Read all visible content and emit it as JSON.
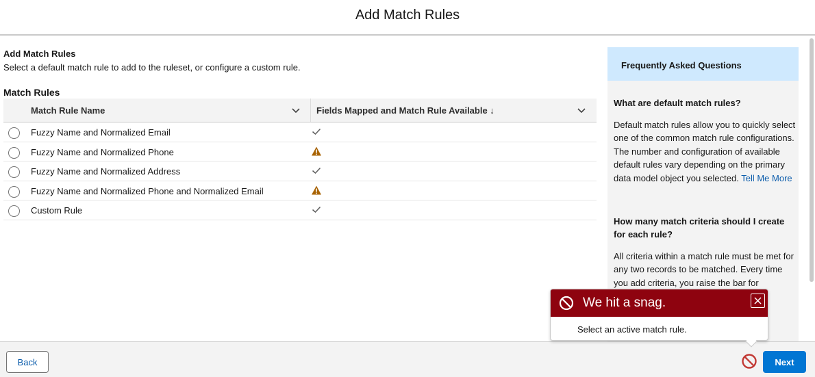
{
  "header": {
    "title": "Add Match Rules"
  },
  "section": {
    "title": "Add Match Rules",
    "description": "Select a default match rule to add to the ruleset, or configure a custom rule."
  },
  "match_rules": {
    "title": "Match Rules",
    "columns": {
      "name": "Match Rule Name",
      "status": "Fields Mapped and Match Rule Available ↓"
    },
    "rows": [
      {
        "name": "Fuzzy Name and Normalized Email",
        "status_icon": "check-icon"
      },
      {
        "name": "Fuzzy Name and Normalized Phone",
        "status_icon": "warning-icon"
      },
      {
        "name": "Fuzzy Name and Normalized Address",
        "status_icon": "check-icon"
      },
      {
        "name": "Fuzzy Name and Normalized Phone and Normalized Email",
        "status_icon": "warning-icon"
      },
      {
        "name": "Custom Rule",
        "status_icon": "check-icon"
      }
    ]
  },
  "faq": {
    "title": "Frequently Asked Questions",
    "q1": "What are default match rules?",
    "a1": "Default match rules allow you to quickly select one of the common match rule configurations. The number and configuration of available default rules vary depending on the primary data model object you selected.",
    "a1_link": "Tell Me More",
    "q2": "How many match criteria should I create for each rule?",
    "a2": "All criteria within a match rule must be met for any two records to be matched. Every time you add criteria, you raise the bar for"
  },
  "error_popover": {
    "title": "We hit a snag.",
    "message": "Select an active match rule."
  },
  "footer": {
    "back_label": "Back",
    "next_label": "Next"
  },
  "colors": {
    "brand": "#0176d3",
    "error": "#8e030f",
    "warning": "#a96404",
    "faq_header": "#cfe9fe"
  }
}
